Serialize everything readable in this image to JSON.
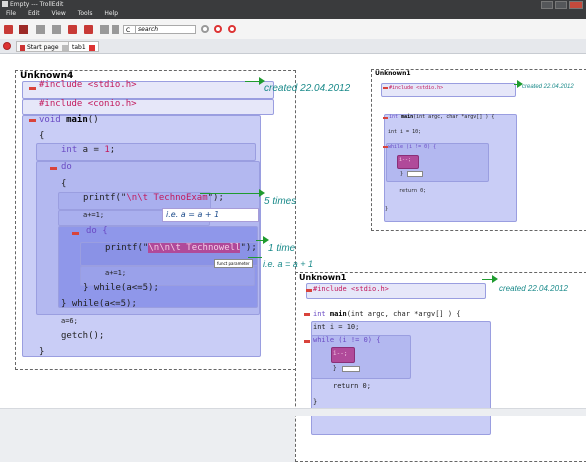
{
  "window": {
    "title": "Empty --- TrollEdit"
  },
  "menu": [
    "File",
    "Edit",
    "View",
    "Tools",
    "Help"
  ],
  "toolbar": {
    "icons": [
      "new-file-icon",
      "open-folder-icon",
      "save-icon",
      "save-as-icon",
      "cut-icon",
      "copy-icon",
      "paste-icon",
      "language-icon"
    ],
    "language": "C",
    "search_placeholder": "search"
  },
  "tabs": [
    {
      "label": "Start page"
    },
    {
      "label": "tab1"
    }
  ],
  "pane_main": {
    "title": "Unknown4",
    "lines": {
      "inc1_a": "#include ",
      "inc1_b": "<stdio.h>",
      "inc2_a": "#include ",
      "inc2_b": "<conio.h>",
      "void_kw": "void ",
      "main_fn": "main",
      "main_tail": "()",
      "brace_open": "{",
      "int_decl_a": "int",
      "int_decl_b": " a = ",
      "int_decl_c": "1",
      "int_decl_d": ";",
      "do1": "do",
      "brace2": "{",
      "printf1_a": "printf(\"",
      "printf1_b": "\\n\\t TechnoExam",
      "printf1_c": "\");",
      "inc_a": "a+=1;",
      "do2": "do {",
      "printf2_a": "printf(\"",
      "printf2_b": "\\n\\n\\t Technowell",
      "printf2_c": "\");",
      "inc_b": "a+=1;",
      "while_inner": "} while(a<=5);",
      "while_outer": "} while(a<=5);",
      "assign": "a=6;",
      "getch": "getch();",
      "brace_close": "}"
    },
    "notes": {
      "created": "created 22.04.2012",
      "ie1": "i.e. a = a + 1",
      "times5": "5 times",
      "time1": "1 time",
      "ie2": "i.e. a = a + 1"
    },
    "tooltip": "funct parameter"
  },
  "pane_topright": {
    "title": "Unknown1",
    "inc": "#include ",
    "inc_file": "<stdio.h>",
    "created": "created 22.04.2012",
    "main_a": "int ",
    "main_b": "main",
    "main_c": "(int argc, char *argv[] )  {",
    "decl": "int i = 10;",
    "while_line": "while (i != 0) {",
    "dec": "i--;",
    "close_inner": "}",
    "ret": "return 0;",
    "close": "}"
  },
  "pane_bottomright": {
    "title": "Unknown1",
    "inc": "#include ",
    "inc_file": "<stdio.h>",
    "created": "created 22.04.2012",
    "main_a": "int ",
    "main_b": "main",
    "main_c": "(int argc, char *argv[] )  {",
    "decl": "int i = 10;",
    "while_line": "while (i != 0) {",
    "dec": "i--;",
    "close_inner": "}",
    "ret": "return 0;",
    "close": "}"
  }
}
